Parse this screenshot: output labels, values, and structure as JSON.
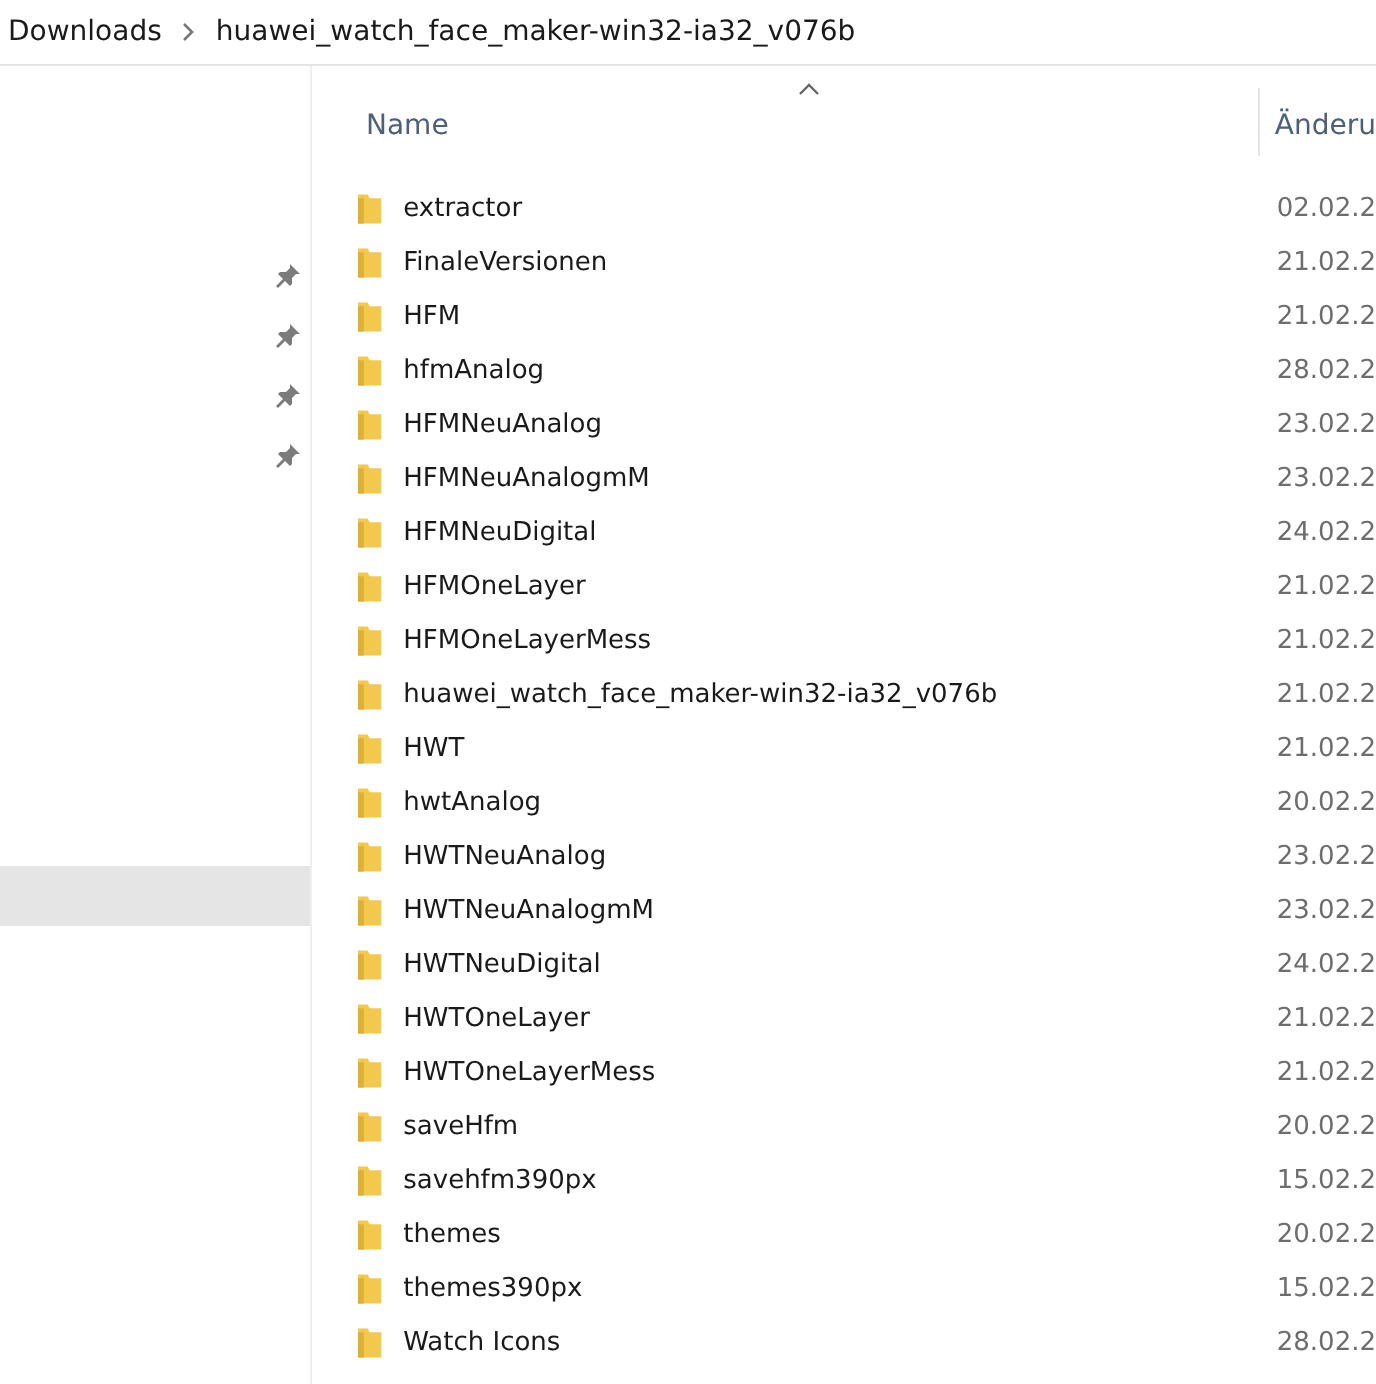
{
  "breadcrumb": [
    "Downloads",
    "huawei_watch_face_maker-win32-ia32_v076b"
  ],
  "nav_pane": {
    "items": [
      {
        "pinned": true,
        "selected": false
      },
      {
        "pinned": true,
        "selected": false
      },
      {
        "pinned": true,
        "selected": false
      },
      {
        "pinned": true,
        "selected": false
      },
      {
        "pinned": false,
        "selected": true
      }
    ]
  },
  "table": {
    "columns": [
      {
        "label": "Name",
        "sorted": true
      },
      {
        "label": "Änderu",
        "sorted": false
      }
    ],
    "rows": [
      {
        "name": "extractor",
        "date": "02.02.2"
      },
      {
        "name": "FinaleVersionen",
        "date": "21.02.2"
      },
      {
        "name": "HFM",
        "date": "21.02.2"
      },
      {
        "name": "hfmAnalog",
        "date": "28.02.2"
      },
      {
        "name": "HFMNeuAnalog",
        "date": "23.02.2"
      },
      {
        "name": "HFMNeuAnalogmM",
        "date": "23.02.2"
      },
      {
        "name": "HFMNeuDigital",
        "date": "24.02.2"
      },
      {
        "name": "HFMOneLayer",
        "date": "21.02.2"
      },
      {
        "name": "HFMOneLayerMess",
        "date": "21.02.2"
      },
      {
        "name": "huawei_watch_face_maker-win32-ia32_v076b",
        "date": "21.02.2"
      },
      {
        "name": "HWT",
        "date": "21.02.2"
      },
      {
        "name": "hwtAnalog",
        "date": "20.02.2"
      },
      {
        "name": "HWTNeuAnalog",
        "date": "23.02.2"
      },
      {
        "name": "HWTNeuAnalogmM",
        "date": "23.02.2"
      },
      {
        "name": "HWTNeuDigital",
        "date": "24.02.2"
      },
      {
        "name": "HWTOneLayer",
        "date": "21.02.2"
      },
      {
        "name": "HWTOneLayerMess",
        "date": "21.02.2"
      },
      {
        "name": "saveHfm",
        "date": "20.02.2"
      },
      {
        "name": "savehfm390px",
        "date": "15.02.2"
      },
      {
        "name": "themes",
        "date": "20.02.2"
      },
      {
        "name": "themes390px",
        "date": "15.02.2"
      },
      {
        "name": "Watch Icons",
        "date": "28.02.2"
      }
    ]
  }
}
